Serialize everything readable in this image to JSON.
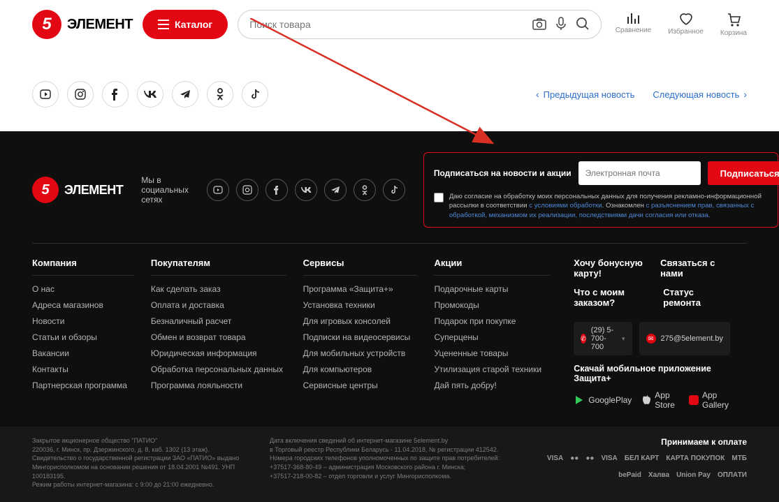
{
  "logoText": "ЭЛЕМЕНТ",
  "logoNum": "5",
  "catalogLabel": "Каталог",
  "searchPlaceholder": "Поиск товара",
  "util": {
    "compare": "Сравнение",
    "favorite": "Избранное",
    "cart": "Корзина"
  },
  "nav": {
    "prev": "Предыдущая новость",
    "next": "Следующая новость"
  },
  "footerSocialLabel": "Мы в социальных сетях",
  "subscribe": {
    "title": "Подписаться на новости и акции",
    "placeholder": "Электронная почта",
    "button": "Подписаться",
    "consentPrefix": "Даю согласие на обработку моих персональных данных для получения рекламно-информационной рассылки в соответствии ",
    "consentLink1": "с условиями обработки",
    "consentMid": ". Ознакомлен ",
    "consentLink2": "с разъяснением прав, связанных с обработкой, механизмом их реализации, последствиями дачи согласия или отказа."
  },
  "cols": {
    "c1": {
      "title": "Компания",
      "items": [
        "О нас",
        "Адреса магазинов",
        "Новости",
        "Статьи и обзоры",
        "Вакансии",
        "Контакты",
        "Партнерская программа"
      ]
    },
    "c2": {
      "title": "Покупателям",
      "items": [
        "Как сделать заказ",
        "Оплата и доставка",
        "Безналичный расчет",
        "Обмен и возврат товара",
        "Юридическая информация",
        "Обработка персональных данных",
        "Программа лояльности"
      ]
    },
    "c3": {
      "title": "Сервисы",
      "items": [
        "Программа «Защита+»",
        "Установка техники",
        "Для игровых консолей",
        "Подписки на видеосервисы",
        "Для мобильных устройств",
        "Для компьютеров",
        "Сервисные центры"
      ]
    },
    "c4": {
      "title": "Акции",
      "items": [
        "Подарочные карты",
        "Промокоды",
        "Подарок при покупке",
        "Суперцены",
        "Уцененные товары",
        "Утилизация старой техники",
        "Дай пять добру!"
      ]
    }
  },
  "right": {
    "bonus": "Хочу бонусную карту!",
    "contact": "Связаться с нами",
    "order": "Что с моим заказом?",
    "repair": "Статус ремонта",
    "phone": "(29) 5-700-700",
    "email": "275@5element.by",
    "appTitle": "Скачай мобильное приложение Защита+",
    "gp": "GooglePlay",
    "as": "App Store",
    "ag": "App Gallery"
  },
  "legal": {
    "l1": "Закрытое акционерное общество \"ПАТИО\"",
    "l2": "220036, г. Минск, пр. Дзержинского, д. 8, каб. 1302 (13 этаж).",
    "l3": "Свидетельство о государственной регистрации ЗАО «ПАТИО» выдано",
    "l4": "Мингорисполкомом на основании решения от 18.04.2001 №491. УНП 100183195.",
    "l5": "Режим работы интернет-магазина: с 9:00 до 21:00 ежедневно.",
    "m1": "Дата включения сведений об интернет-магазине 5element.by",
    "m2": "в Торговый реестр Республики Беларусь - 11.04.2018, № регистрации 412542.",
    "m3": "Номера городских телефонов уполномоченных по защите прав потребителей:",
    "m4": "+37517-368-80-49 – администрация Московского района г. Минска;",
    "m5": "+37517-218-00-82 – отдел торговли и услуг Мингорисполкома.",
    "payTitle": "Принимаем к оплате",
    "pay": [
      "VISA",
      "●●",
      "●●",
      "VISA",
      "БЕЛ КАРТ",
      "КАРТА ПОКУПОК",
      "МТБ",
      "bePaid",
      "Халва",
      "Union Pay",
      "ОПЛАТИ"
    ]
  }
}
